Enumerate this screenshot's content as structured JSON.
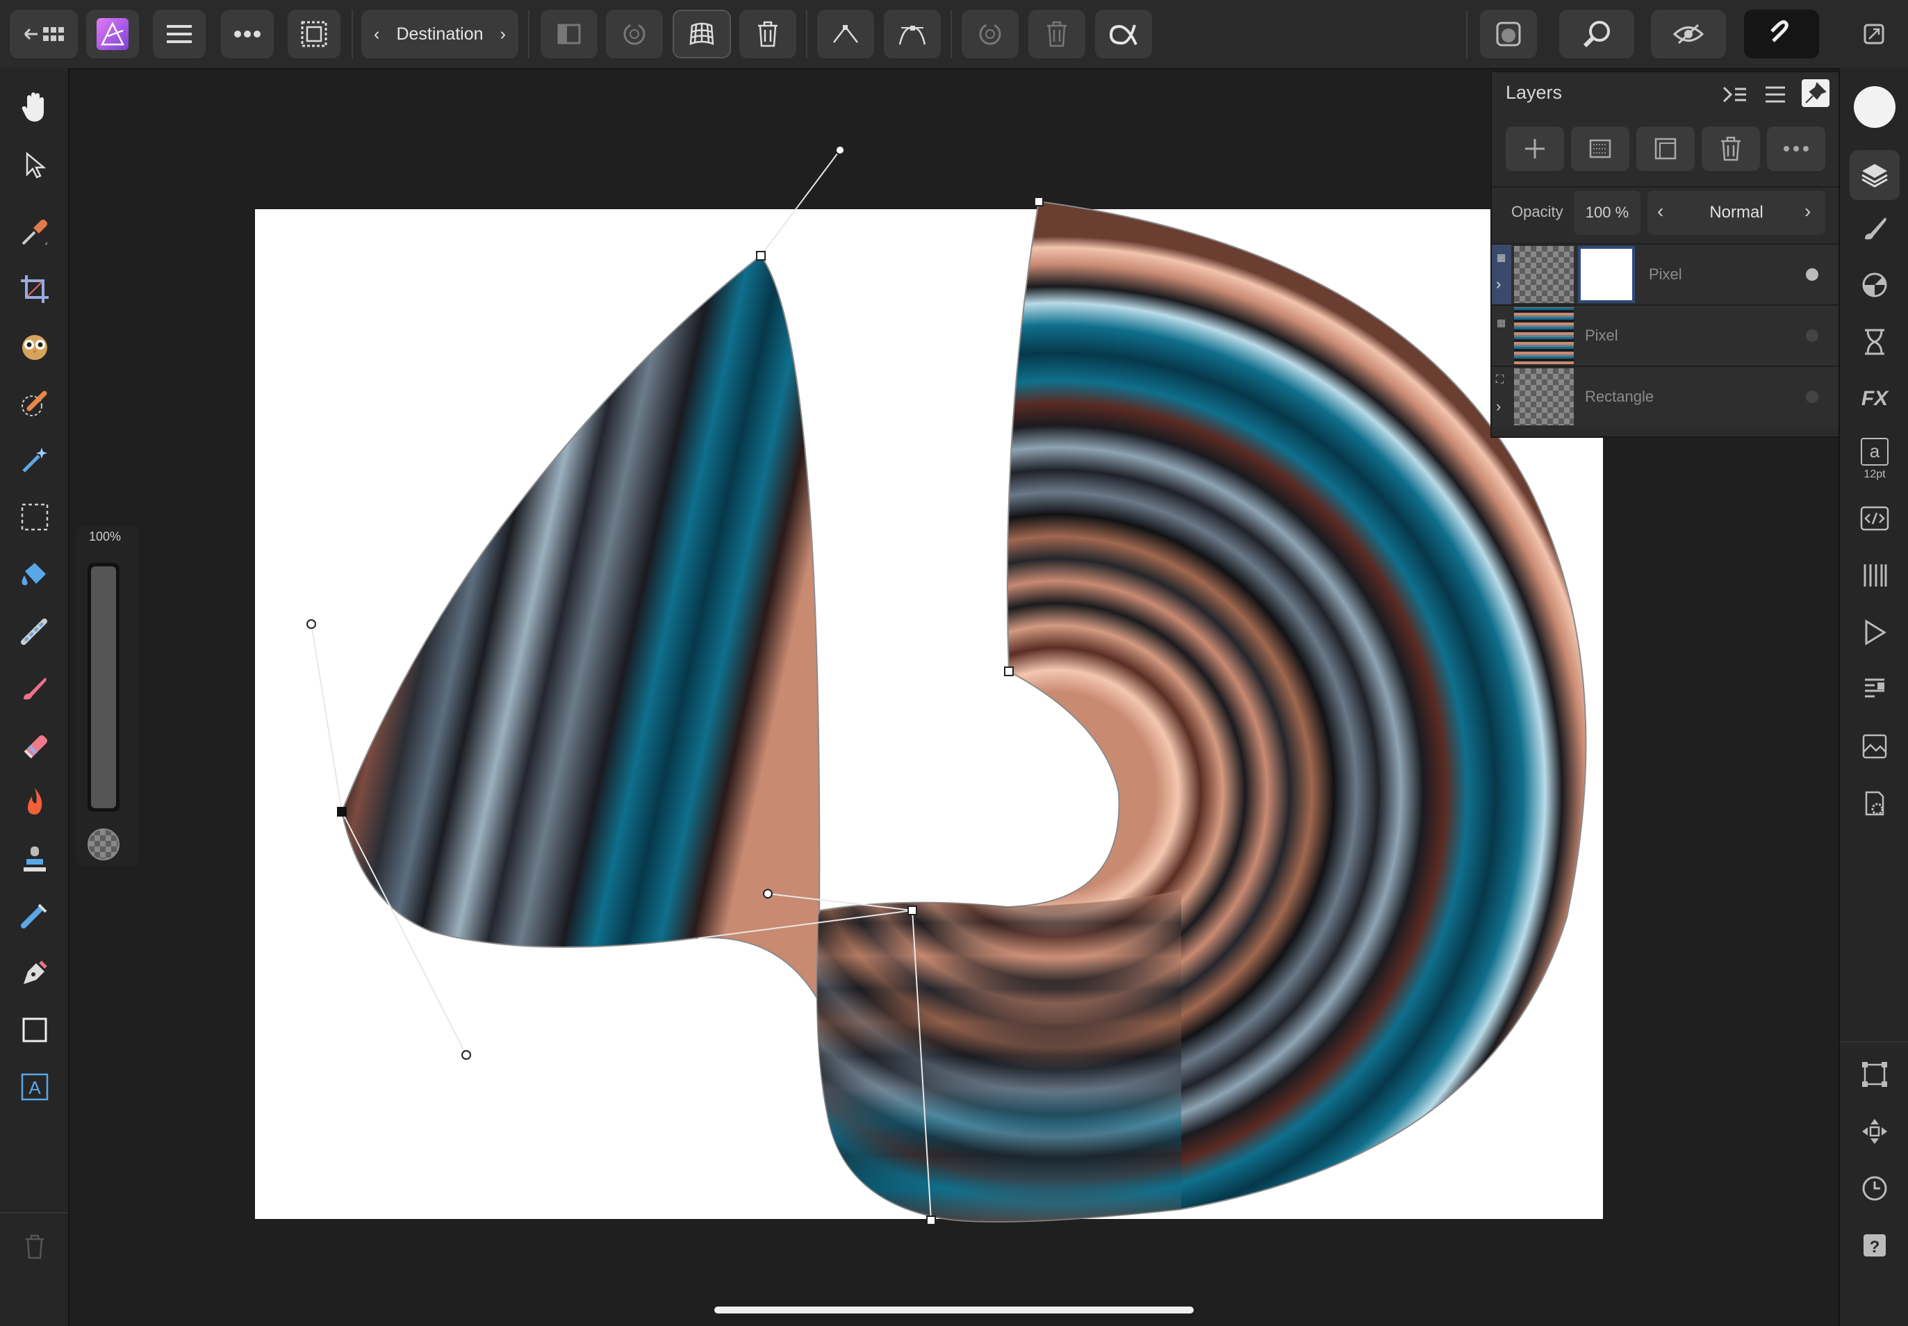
{
  "toolbar": {
    "nav_label": "Destination",
    "back_icon": "back-to-gallery-icon",
    "app_icon": "affinity-photo-logo"
  },
  "left_tools": {
    "brush_size_label": "100%"
  },
  "layers_panel": {
    "title": "Layers",
    "opacity_label": "Opacity",
    "opacity_value": "100 %",
    "blend_mode": "Normal",
    "layers": [
      {
        "name": "Pixel",
        "selected": true
      },
      {
        "name": "Pixel",
        "selected": false
      },
      {
        "name": "Rectangle",
        "selected": false
      }
    ]
  },
  "right_studio": {
    "text_size_label": "12pt",
    "text_glyph": "a",
    "fx_label": "FX"
  },
  "colors": {
    "accent": "#b36cf0",
    "copper": "#c98a72",
    "teal": "#0f6f8c",
    "canvas_bg": "#1f1f1f",
    "document": "#ffffff"
  }
}
